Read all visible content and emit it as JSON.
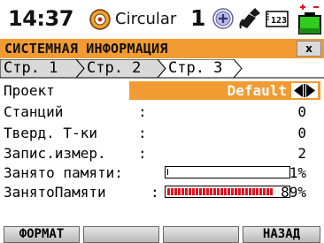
{
  "status": {
    "time": "14:37",
    "mode": "Circular",
    "sat_count": "1",
    "card_label": "123"
  },
  "window": {
    "title": "СИСТЕМНАЯ ИНФОРМАЦИЯ",
    "close_label": "x"
  },
  "tabs": [
    {
      "label": "Стр. 1",
      "active": false
    },
    {
      "label": "Стр. 2",
      "active": false
    },
    {
      "label": "Стр. 3",
      "active": true
    }
  ],
  "fields": {
    "project": {
      "label": "Проект",
      "value": "Default"
    },
    "stations": {
      "label": "Станций",
      "colon": ":",
      "value": "0"
    },
    "fixed_points": {
      "label": "Тверд. Т-ки",
      "colon": ":",
      "value": "0"
    },
    "records": {
      "label": "Запис.измер.",
      "colon": ":",
      "value": "2"
    },
    "memory_used_1": {
      "label": "Занято памяти:",
      "value": "1%",
      "fraction": 0.01
    },
    "memory_used_2": {
      "label": "ЗанятоПамяти",
      "colon": ":",
      "value": "89%",
      "fraction": 0.89
    }
  },
  "softkeys": {
    "format": "ФОРМАТ",
    "f2": "",
    "f3": "",
    "back": "НАЗАД"
  },
  "colors": {
    "accent": "#f29b32",
    "bar_red": "#e0141e",
    "active_tab_bg": "#ffffff",
    "inactive_tab_bg": "#d9d9d9"
  }
}
